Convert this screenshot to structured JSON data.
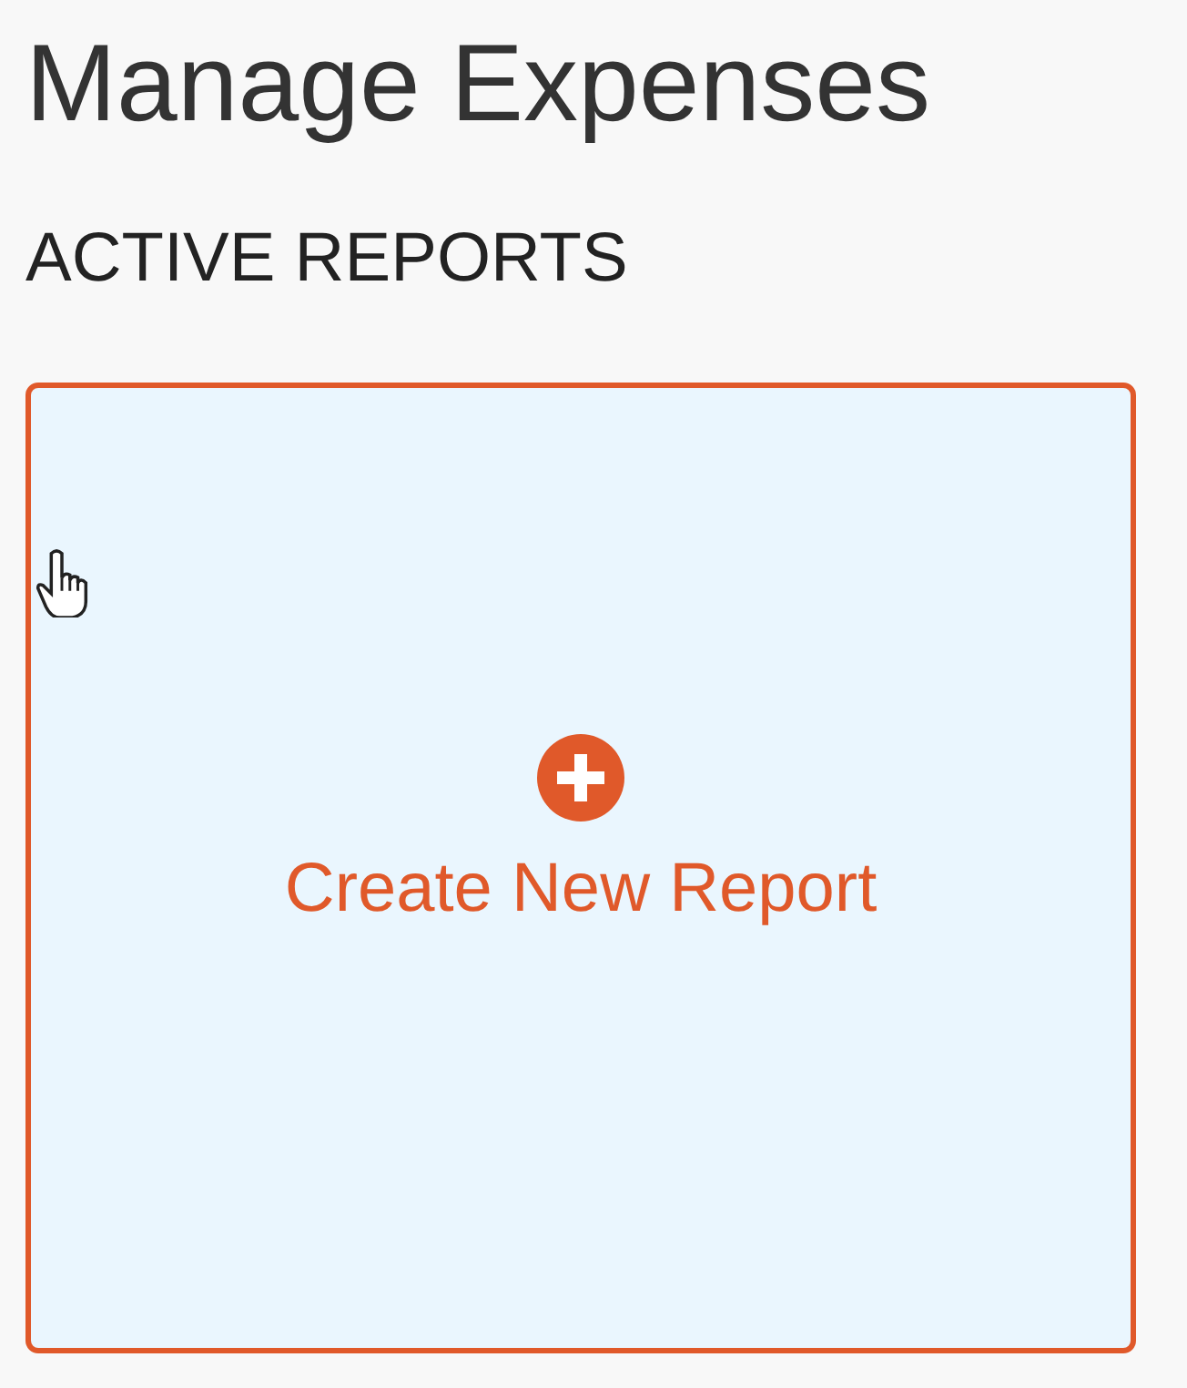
{
  "page": {
    "title": "Manage Expenses"
  },
  "section": {
    "heading": "ACTIVE REPORTS"
  },
  "create_card": {
    "label": "Create New Report"
  }
}
